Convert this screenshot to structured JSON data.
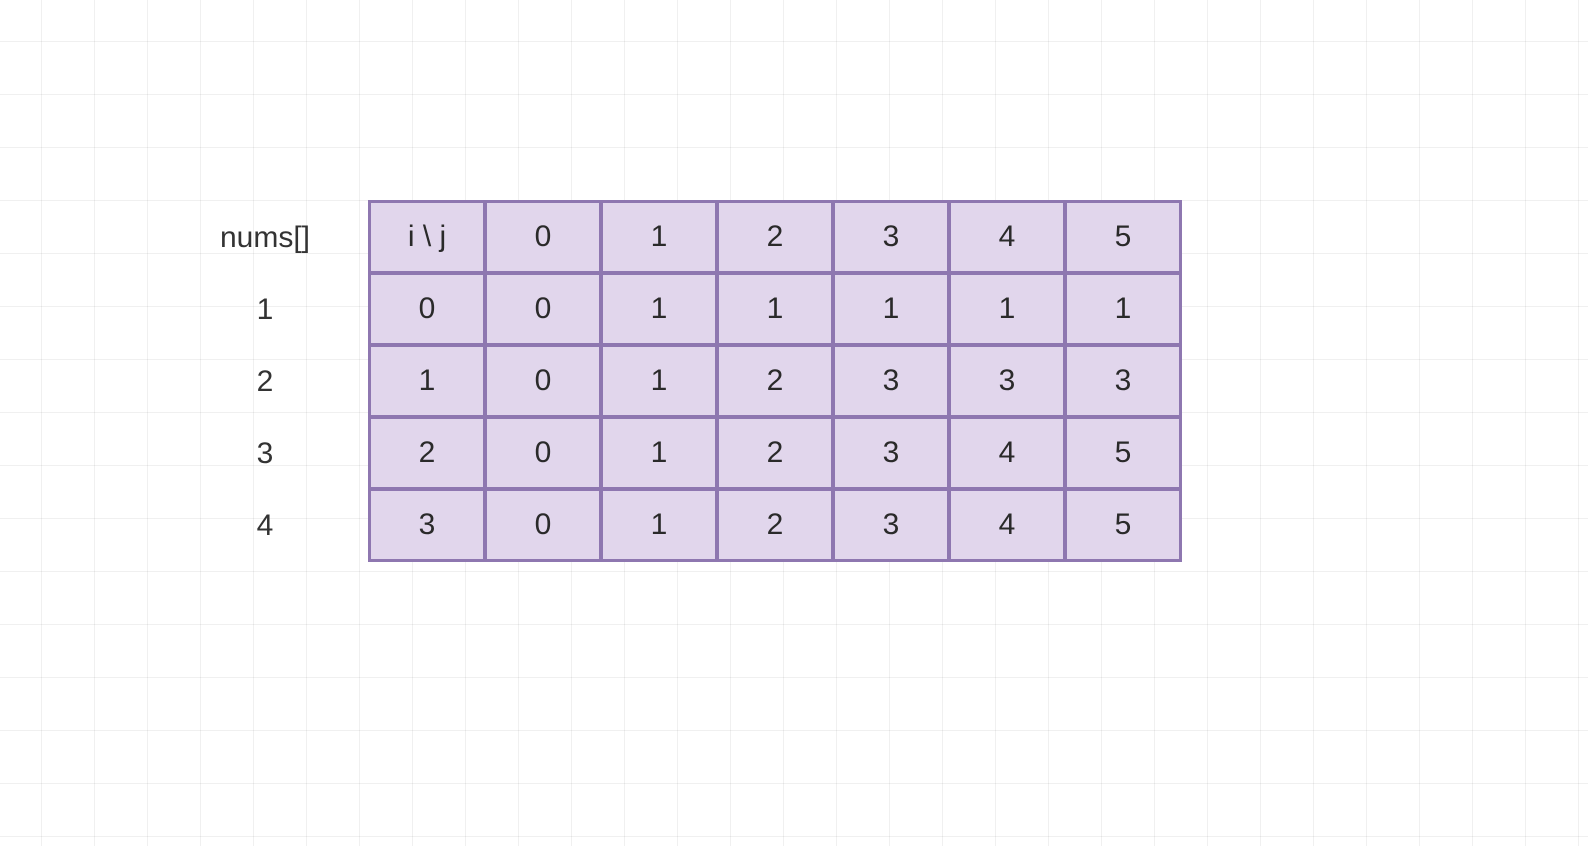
{
  "labels": {
    "nums_header": "nums[]",
    "corner": "i \\ j"
  },
  "nums": [
    "1",
    "2",
    "3",
    "4"
  ],
  "col_headers": [
    "0",
    "1",
    "2",
    "3",
    "4",
    "5"
  ],
  "row_indexes": [
    "0",
    "1",
    "2",
    "3"
  ],
  "grid": [
    [
      "0",
      "1",
      "1",
      "1",
      "1",
      "1"
    ],
    [
      "0",
      "1",
      "2",
      "3",
      "3",
      "3"
    ],
    [
      "0",
      "1",
      "2",
      "3",
      "4",
      "5"
    ],
    [
      "0",
      "1",
      "2",
      "3",
      "4",
      "5"
    ]
  ],
  "chart_data": {
    "type": "table",
    "title": "DP table indexed by i (rows) and j (columns), with nums[] shown at left",
    "row_label": "i",
    "col_label": "j",
    "nums": [
      1,
      2,
      3,
      4
    ],
    "columns": [
      0,
      1,
      2,
      3,
      4,
      5
    ],
    "values": [
      [
        0,
        1,
        1,
        1,
        1,
        1
      ],
      [
        0,
        1,
        2,
        3,
        3,
        3
      ],
      [
        0,
        1,
        2,
        3,
        4,
        5
      ],
      [
        0,
        1,
        2,
        3,
        4,
        5
      ]
    ]
  }
}
